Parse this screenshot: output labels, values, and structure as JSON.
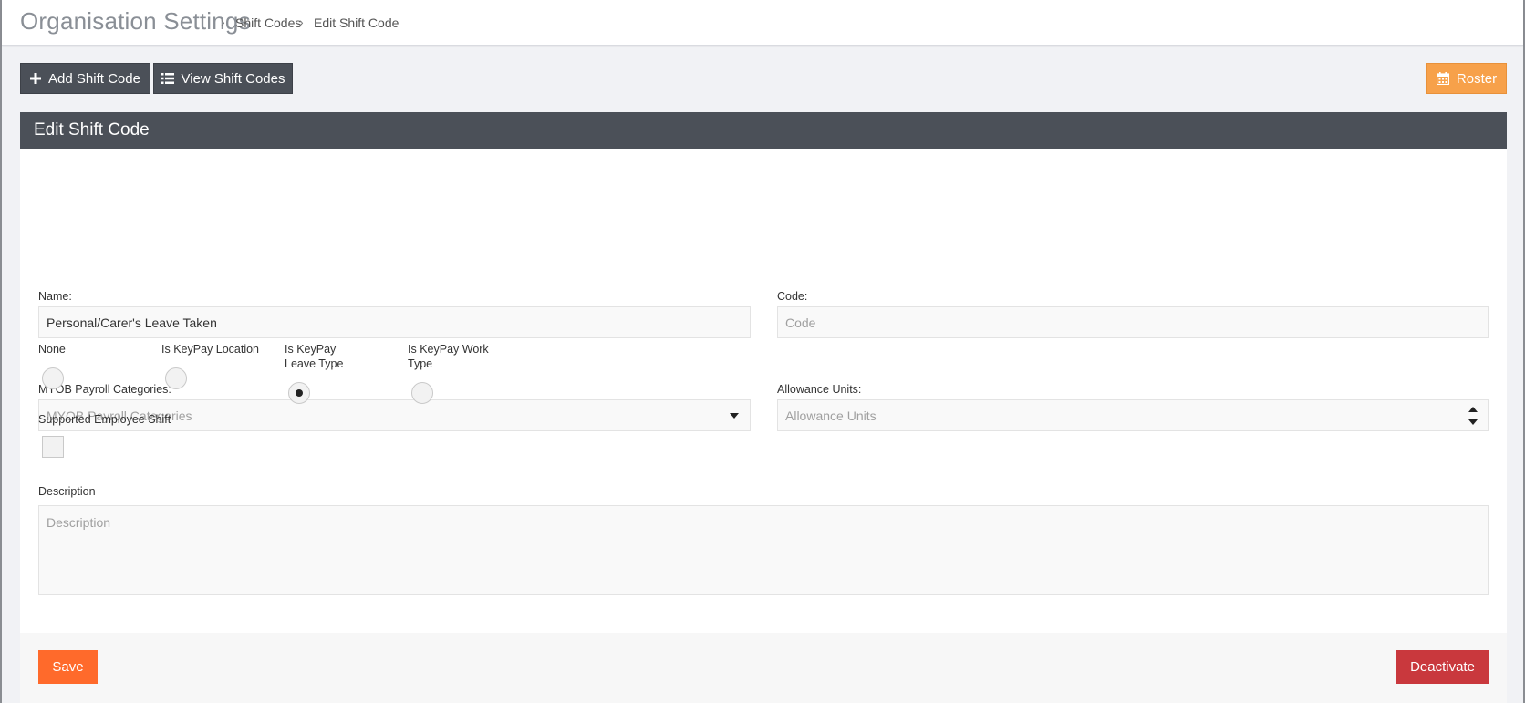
{
  "header": {
    "title": "Organisation Settings",
    "breadcrumb": [
      "Shift Codes",
      "Edit Shift Code"
    ],
    "separator": "›"
  },
  "toolbar": {
    "add_label": "Add Shift Code",
    "view_label": "View Shift Codes",
    "roster_label": "Roster"
  },
  "panel": {
    "title": "Edit Shift Code"
  },
  "form": {
    "name_label": "Name:",
    "name_value": "Personal/Carer's Leave Taken",
    "code_label": "Code:",
    "code_placeholder": "Code",
    "myob_label": "MYOB Payroll Categories:",
    "myob_placeholder": "MYOB Payroll Categories",
    "allowance_label": "Allowance Units:",
    "allowance_placeholder": "Allowance Units",
    "radio_options": [
      {
        "label": "None",
        "checked": false
      },
      {
        "label": "Is KeyPay Location",
        "checked": false
      },
      {
        "label": "Is KeyPay Leave Type",
        "checked": true
      },
      {
        "label": "Is KeyPay Work Type",
        "checked": false
      }
    ],
    "supported_label": "Supported Employee Shift",
    "supported_checked": false,
    "description_label": "Description",
    "description_placeholder": "Description"
  },
  "footer": {
    "save_label": "Save",
    "deactivate_label": "Deactivate"
  },
  "colors": {
    "dark": "#4b5058",
    "roster": "#f7a14a",
    "save": "#ff6a2b",
    "deactivate": "#c9383d"
  }
}
